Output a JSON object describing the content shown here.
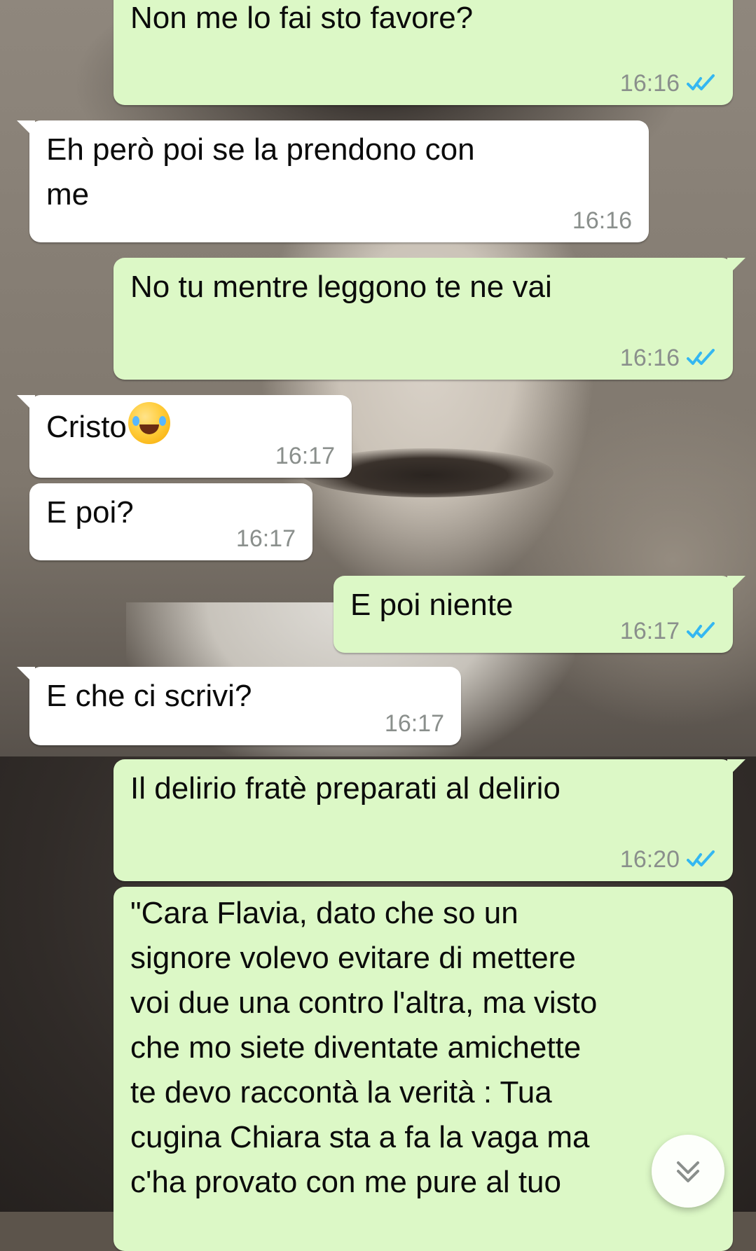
{
  "chat": {
    "messages": [
      {
        "direction": "out",
        "text": "Non me lo fai sto favore?",
        "time": "16:16",
        "status_icon": "double-check-read-icon"
      },
      {
        "direction": "in",
        "text": "Eh però poi se la prendono con\nme",
        "time": "16:16"
      },
      {
        "direction": "out",
        "text": "No tu mentre leggono te ne vai",
        "time": "16:16",
        "status_icon": "double-check-read-icon"
      },
      {
        "direction": "in",
        "text": "Cristo",
        "time": "16:17",
        "emoji_icon": "face-with-tears-of-joy-icon"
      },
      {
        "direction": "in",
        "text": "E poi?",
        "time": "16:17"
      },
      {
        "direction": "out",
        "text": "E poi niente",
        "time": "16:17",
        "status_icon": "double-check-read-icon"
      },
      {
        "direction": "in",
        "text": "E che ci scrivi?",
        "time": "16:17"
      },
      {
        "direction": "out",
        "text": "Il delirio fratè preparati al delirio",
        "time": "16:20",
        "status_icon": "double-check-read-icon"
      },
      {
        "direction": "out",
        "text": "\"Cara Flavia, dato che so un\nsignore volevo evitare di mettere\nvoi due una contro l'altra, ma visto\nche mo siete diventate amichette\nte devo raccontà la verità : Tua\ncugina Chiara sta a fa la vaga ma\nc'ha provato con me pure al tuo"
      }
    ]
  },
  "scroll_button": {
    "icon": "double-chevron-down-icon"
  },
  "colors": {
    "outgoing_bubble": "#dcf8c6",
    "incoming_bubble": "#ffffff",
    "read_ticks": "#34b7f1",
    "time_text": "#8a8f8c"
  }
}
